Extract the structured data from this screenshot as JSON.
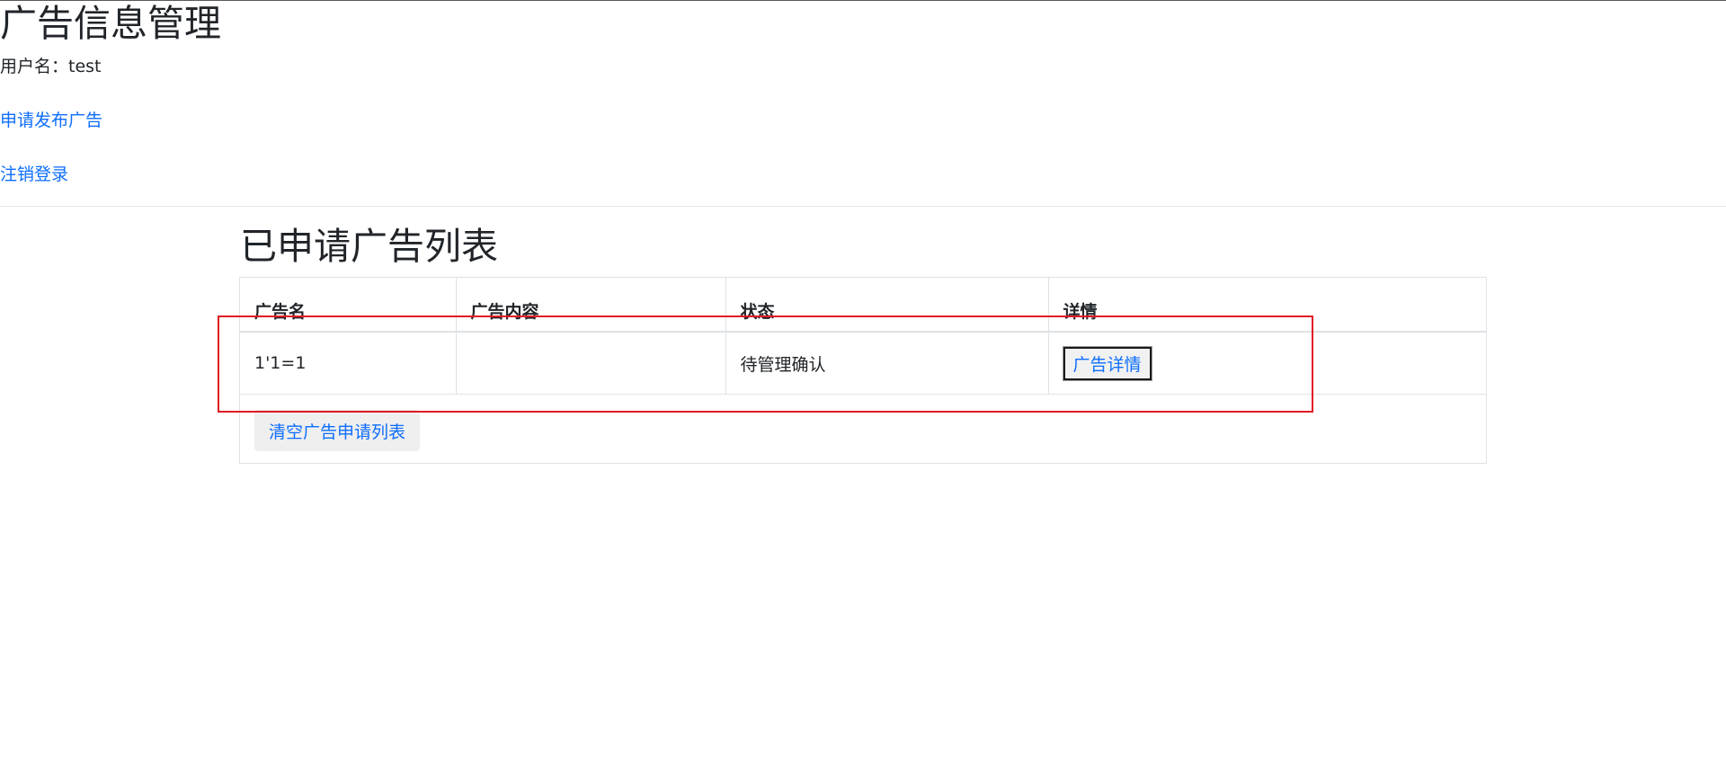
{
  "header": {
    "title": "广告信息管理",
    "user_line": "用户名：test"
  },
  "nav": {
    "apply_link": "申请发布广告",
    "logout_link": "注销登录"
  },
  "list": {
    "title": "已申请广告列表",
    "columns": [
      "广告名",
      "广告内容",
      "状态",
      "详情"
    ],
    "rows": [
      {
        "name": "1'1=1",
        "content": "",
        "status": "待管理确认",
        "detail_button": "广告详情"
      }
    ],
    "clear_button": "清空广告申请列表"
  },
  "colors": {
    "link": "#0d6efd",
    "text": "#212529",
    "highlight_border": "#e01b24"
  }
}
